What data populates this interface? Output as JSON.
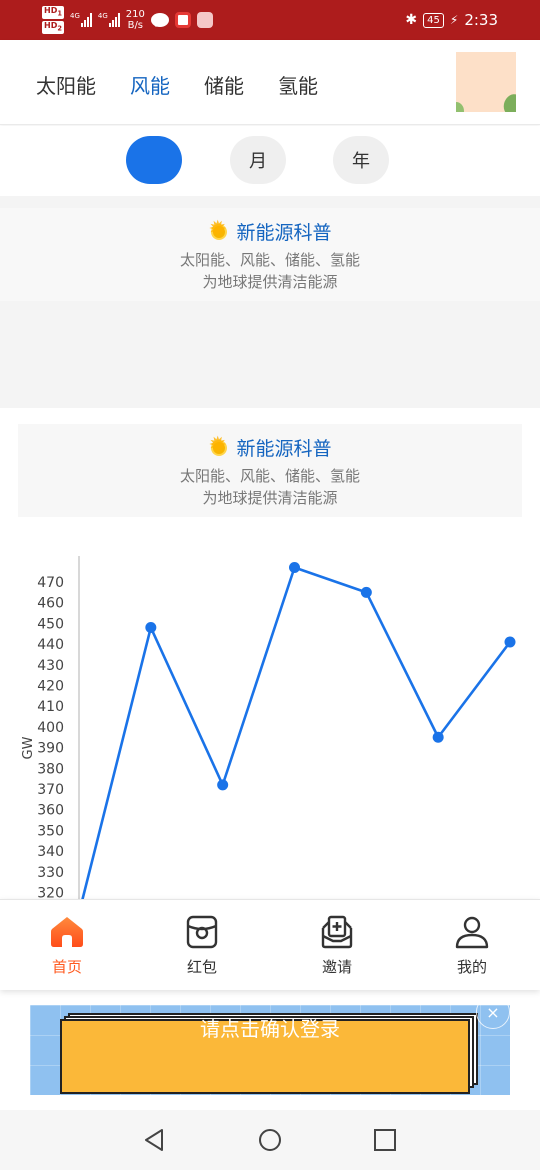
{
  "status_bar": {
    "hd1": "HD",
    "hd1_sub": "1",
    "hd2": "HD",
    "hd2_sub": "2",
    "net1": "4G",
    "net2": "4G",
    "net_speed_value": "210",
    "net_speed_unit": "B/s",
    "battery": "45",
    "time": "2:33",
    "icons": [
      "wechat-icon",
      "video-app-icon",
      "shop-app-icon",
      "bluetooth-icon",
      "charging-icon"
    ]
  },
  "top_tabs": {
    "items": [
      {
        "label": "太阳能",
        "active": false
      },
      {
        "label": "风能",
        "active": true
      },
      {
        "label": "储能",
        "active": false
      },
      {
        "label": "氢能",
        "active": false
      }
    ]
  },
  "periods": {
    "items": [
      {
        "label": "",
        "active": true
      },
      {
        "label": "月",
        "active": false
      },
      {
        "label": "年",
        "active": false
      }
    ]
  },
  "cards": [
    {
      "title": "新能源科普",
      "line1": "太阳能、风能、储能、氢能",
      "line2": "为地球提供清洁能源"
    },
    {
      "title": "新能源科普",
      "line1": "太阳能、风能、储能、氢能",
      "line2": "为地球提供清洁能源"
    }
  ],
  "chart_data": {
    "type": "line",
    "ylabel": "GW",
    "ylim": [
      310,
      480
    ],
    "y_ticks": [
      "470",
      "460",
      "450",
      "440",
      "430",
      "420",
      "410",
      "400",
      "390",
      "380",
      "370",
      "360",
      "350",
      "340",
      "330",
      "320"
    ],
    "series": [
      {
        "values": [
          310,
          448,
          372,
          477,
          465,
          395,
          441
        ]
      }
    ],
    "color": "#1a73e8",
    "grid": false
  },
  "bottom_nav": {
    "items": [
      {
        "label": "首页",
        "icon": "home-icon",
        "active": true
      },
      {
        "label": "红包",
        "icon": "red-packet-icon",
        "active": false
      },
      {
        "label": "邀请",
        "icon": "invite-icon",
        "active": false
      },
      {
        "label": "我的",
        "icon": "profile-icon",
        "active": false
      }
    ],
    "active_color": "#ff5a1f"
  },
  "banner": {
    "text": "请点击确认登录",
    "close": "×"
  },
  "system_nav": [
    "back-icon",
    "home-circle-icon",
    "recents-icon"
  ]
}
